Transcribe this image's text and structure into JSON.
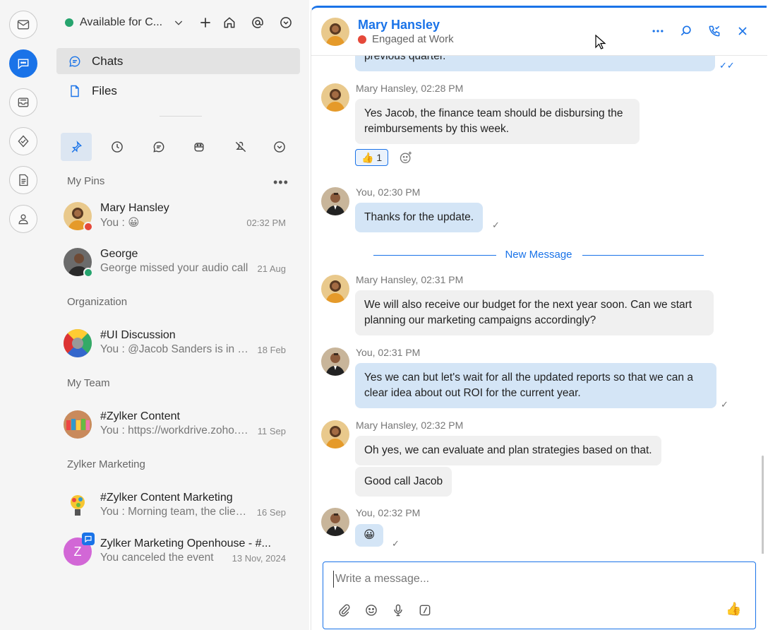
{
  "colors": {
    "accent": "#1a73e8",
    "available": "#26a46e",
    "busy": "#e5493a",
    "my_bubble": "#d4e5f6",
    "their_bubble": "#f0f0f0"
  },
  "rail": {
    "items": [
      {
        "icon": "mail-icon"
      },
      {
        "icon": "chat-icon",
        "active": true
      },
      {
        "icon": "inbox-icon"
      },
      {
        "icon": "tasks-icon"
      },
      {
        "icon": "notes-icon"
      },
      {
        "icon": "contacts-icon"
      }
    ]
  },
  "sidebar": {
    "status_label": "Available for C...",
    "nav": {
      "chats": "Chats",
      "files": "Files"
    },
    "filters": [
      "pin-icon",
      "recent-icon",
      "chat-bubble-icon",
      "bot-icon",
      "muted-icon",
      "more-chevron-icon"
    ],
    "sections": {
      "pins": "My Pins",
      "org": "Organization",
      "team": "My Team",
      "marketing": "Zylker Marketing"
    },
    "conversations": [
      {
        "name": "Mary Hansley",
        "snippet": "You : 😀",
        "time": "02:32 PM"
      },
      {
        "name": "George",
        "snippet": "George missed your audio call",
        "time": "21 Aug"
      },
      {
        "name": "#UI Discussion",
        "snippet": "You : @Jacob Sanders  is in the loop",
        "time": "18 Feb"
      },
      {
        "name": "#Zylker Content",
        "snippet": "You : https://workdrive.zoho.com",
        "time": "11 Sep"
      },
      {
        "name": "#Zylker Content Marketing",
        "snippet": "You : Morning team, the client call",
        "time": "16 Sep"
      },
      {
        "name": "Zylker Marketing Openhouse - #...",
        "snippet": "You canceled the event",
        "time": "13 Nov, 2024",
        "initial": "Z"
      }
    ]
  },
  "chat": {
    "header": {
      "name": "Mary Hansley",
      "status": "Engaged at Work"
    },
    "messages": {
      "m0_text": "previous quarter.",
      "m1_meta": "Mary  Hansley, 02:28 PM",
      "m1_text": "Yes Jacob, the finance team should be disbursing the reimbursements by this week.",
      "m1_reaction": "👍 1",
      "m2_meta": "You, 02:30 PM",
      "m2_text": "Thanks for the update.",
      "new_message": "New Message",
      "m3_meta": "Mary  Hansley, 02:31 PM",
      "m3_text": "We will also receive our budget for the next year soon. Can we start planning our marketing campaigns accordingly?",
      "m4_meta": "You, 02:31 PM",
      "m4_text": "Yes we can but let's wait for all the updated reports so that we can a clear idea about out ROI for the current year.",
      "m5_meta": "Mary  Hansley, 02:32 PM",
      "m5_text": "Oh yes, we can evaluate and plan strategies based on that.",
      "m6_text": "Good call Jacob",
      "m7_meta": "You, 02:32 PM",
      "m7_text": "😀"
    },
    "composer": {
      "placeholder": "Write a message...",
      "send_emoji": "👍"
    }
  }
}
